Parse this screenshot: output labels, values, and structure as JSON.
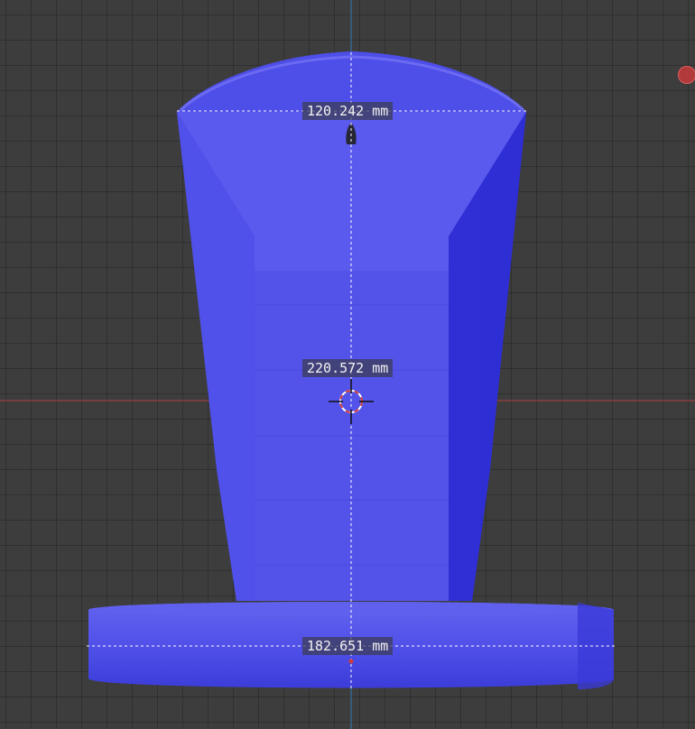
{
  "viewport": {
    "background": "#3d3d3d",
    "grid_color": "#2f2f2f",
    "x_axis_color": "#b33a3a",
    "z_axis_color": "#2f79b5",
    "model_color": "#5b5be8"
  },
  "measurements": {
    "top_width": "120.242 mm",
    "height": "220.572 mm",
    "base_width": "182.651 mm"
  },
  "icons": {
    "origin": "3d-cursor-icon",
    "gizmo": "axis-gizmo-icon"
  }
}
